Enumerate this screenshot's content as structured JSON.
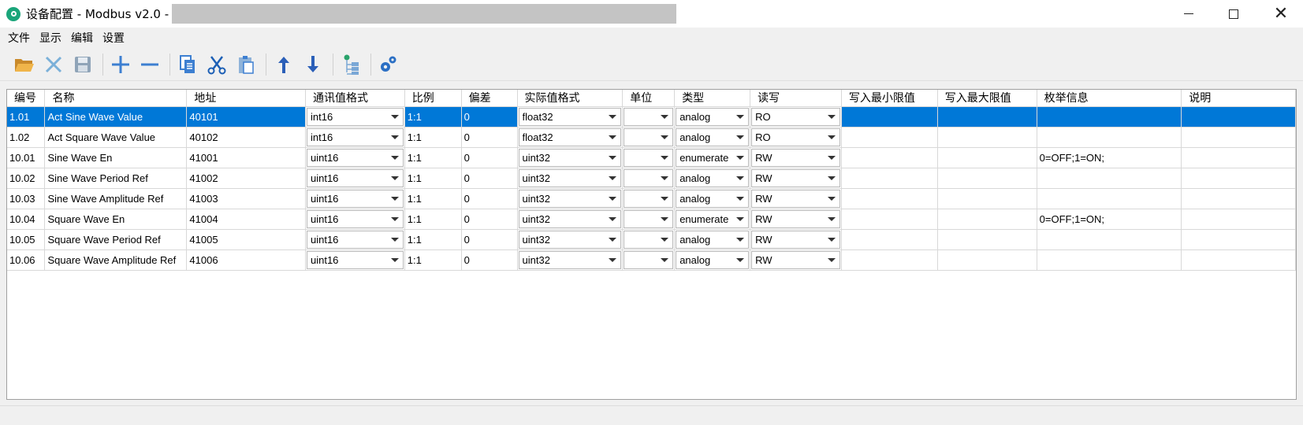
{
  "window": {
    "title": "设备配置 - Modbus v2.0 -",
    "minimize_label": "minimize",
    "maximize_label": "maximize",
    "close_label": "close"
  },
  "menu": [
    "文件",
    "显示",
    "编辑",
    "设置"
  ],
  "toolbar": {
    "buttons": [
      {
        "icon": "folder-open-icon",
        "color": "#e7a93c"
      },
      {
        "icon": "close-x-icon",
        "color": "#7ab0d9"
      },
      {
        "icon": "save-icon",
        "color": "#8fa4b8"
      },
      {
        "icon": "plus-icon",
        "color": "#3d7fd1"
      },
      {
        "icon": "minus-icon",
        "color": "#3d7fd1"
      },
      {
        "icon": "copy-icon",
        "color": "#3d7fd1"
      },
      {
        "icon": "cut-icon",
        "color": "#3d7fd1"
      },
      {
        "icon": "paste-icon",
        "color": "#3d7fd1"
      },
      {
        "icon": "arrow-up-icon",
        "color": "#2b5fb8"
      },
      {
        "icon": "arrow-down-icon",
        "color": "#2b5fb8"
      },
      {
        "icon": "tree-add-icon",
        "color": "#2aa36b"
      },
      {
        "icon": "settings-gears-icon",
        "color": "#2b6fc4"
      }
    ]
  },
  "table": {
    "columns": [
      "编号",
      "名称",
      "地址",
      "通讯值格式",
      "比例",
      "偏差",
      "实际值格式",
      "单位",
      "类型",
      "读写",
      "写入最小限值",
      "写入最大限值",
      "枚举信息",
      "说明"
    ],
    "rows": [
      {
        "id": "1.01",
        "name": "Act Sine Wave Value",
        "address": "40101",
        "comm_format": "int16",
        "ratio": "1:1",
        "offset": "0",
        "actual_format": "float32",
        "unit": "",
        "type": "analog",
        "rw": "RO",
        "min": "",
        "max": "",
        "enum": "",
        "desc": ""
      },
      {
        "id": "1.02",
        "name": "Act Square Wave Value",
        "address": "40102",
        "comm_format": "int16",
        "ratio": "1:1",
        "offset": "0",
        "actual_format": "float32",
        "unit": "",
        "type": "analog",
        "rw": "RO",
        "min": "",
        "max": "",
        "enum": "",
        "desc": ""
      },
      {
        "id": "10.01",
        "name": "Sine Wave En",
        "address": "41001",
        "comm_format": "uint16",
        "ratio": "1:1",
        "offset": "0",
        "actual_format": "uint32",
        "unit": "",
        "type": "enumerate",
        "rw": "RW",
        "min": "",
        "max": "",
        "enum": "0=OFF;1=ON;",
        "desc": ""
      },
      {
        "id": "10.02",
        "name": "Sine Wave Period Ref",
        "address": "41002",
        "comm_format": "uint16",
        "ratio": "1:1",
        "offset": "0",
        "actual_format": "uint32",
        "unit": "",
        "type": "analog",
        "rw": "RW",
        "min": "",
        "max": "",
        "enum": "",
        "desc": ""
      },
      {
        "id": "10.03",
        "name": "Sine Wave Amplitude Ref",
        "address": "41003",
        "comm_format": "uint16",
        "ratio": "1:1",
        "offset": "0",
        "actual_format": "uint32",
        "unit": "",
        "type": "analog",
        "rw": "RW",
        "min": "",
        "max": "",
        "enum": "",
        "desc": ""
      },
      {
        "id": "10.04",
        "name": "Square Wave En",
        "address": "41004",
        "comm_format": "uint16",
        "ratio": "1:1",
        "offset": "0",
        "actual_format": "uint32",
        "unit": "",
        "type": "enumerate",
        "rw": "RW",
        "min": "",
        "max": "",
        "enum": "0=OFF;1=ON;",
        "desc": ""
      },
      {
        "id": "10.05",
        "name": "Square Wave Period Ref",
        "address": "41005",
        "comm_format": "uint16",
        "ratio": "1:1",
        "offset": "0",
        "actual_format": "uint32",
        "unit": "",
        "type": "analog",
        "rw": "RW",
        "min": "",
        "max": "",
        "enum": "",
        "desc": ""
      },
      {
        "id": "10.06",
        "name": "Square Wave Amplitude Ref",
        "address": "41006",
        "comm_format": "uint16",
        "ratio": "1:1",
        "offset": "0",
        "actual_format": "uint32",
        "unit": "",
        "type": "analog",
        "rw": "RW",
        "min": "",
        "max": "",
        "enum": "",
        "desc": ""
      }
    ],
    "selected_row": 0,
    "selection_color": "#0078d7"
  }
}
